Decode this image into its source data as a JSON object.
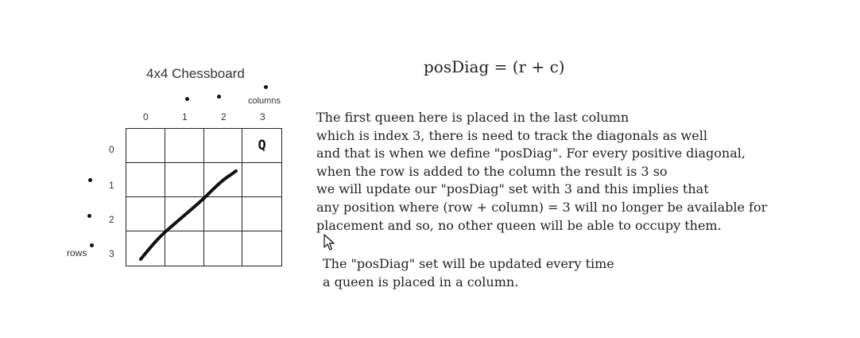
{
  "board": {
    "title": "4x4 Chessboard",
    "columns_label": "columns",
    "rows_label": "rows",
    "column_indices": [
      "0",
      "1",
      "2",
      "3"
    ],
    "row_indices": [
      "0",
      "1",
      "2",
      "3"
    ],
    "queen": {
      "symbol": "Q",
      "row": 0,
      "column": 3
    }
  },
  "formula": "posDiag = (r + c)",
  "explanation": [
    "The first queen here is placed in the last column",
    "which is index 3, there is need to track the diagonals as well",
    "and that is when we define \"posDiag\". For every positive diagonal,",
    "when the row is added to the column the result is 3 so",
    "we will update our \"posDiag\" set with 3 and this implies that",
    "any position where (row + column) = 3 will no longer be available for",
    "placement and so, no other queen will be able to occupy them."
  ],
  "note": [
    "The \"posDiag\" set will be updated every time",
    "a queen is placed in a column."
  ],
  "colors": {
    "ink": "#111111",
    "background": "#ffffff"
  }
}
